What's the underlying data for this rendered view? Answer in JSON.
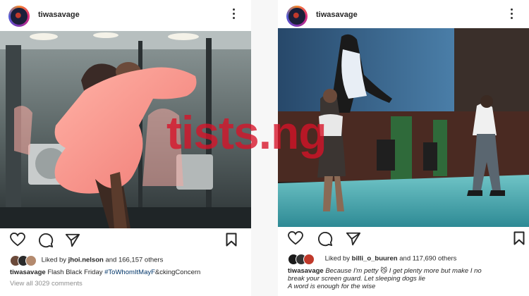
{
  "watermark": "tists.ng",
  "left_post": {
    "username": "tiwasavage",
    "liked_by_prefix": "Liked by",
    "liked_by_user": "jhoi.nelson",
    "liked_by_suffix": "and 166,157 others",
    "caption_user": "tiwasavage",
    "caption_text": "Flash Black Friday",
    "caption_hashtag": "#ToWhomItMayF",
    "caption_tail": "&ckingConcern",
    "view_comments": "View all 3029 comments"
  },
  "right_post": {
    "username": "tiwasavage",
    "liked_by_prefix": "Liked by",
    "liked_by_user": "billi_o_buuren",
    "liked_by_suffix": "and 117,690 others",
    "caption_user": "tiwasavage",
    "caption_line1": "Because I'm petty 😼 I get plenty more but make I no",
    "caption_line2": "break your screen guard. Let sleeping dogs lie",
    "caption_line3": "A word is enough for the wise"
  },
  "icons": [
    "avatar",
    "more-options-icon",
    "heart-icon",
    "comment-icon",
    "share-icon",
    "bookmark-icon"
  ],
  "colors": {
    "hashtag": "#003569",
    "watermark": "#d71228",
    "muted": "#8e8e8e"
  }
}
